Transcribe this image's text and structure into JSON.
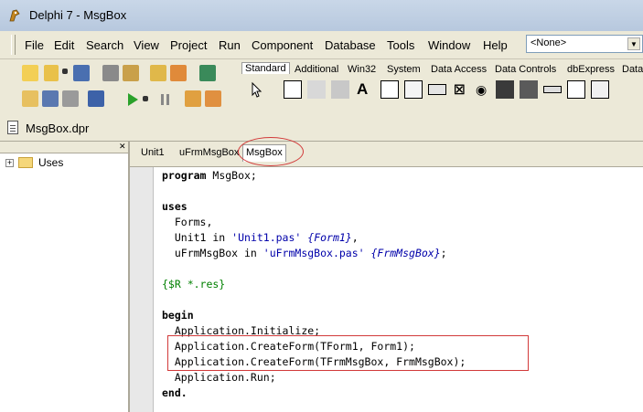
{
  "window": {
    "title": "Delphi 7 - MsgBox"
  },
  "menu": {
    "items": [
      "File",
      "Edit",
      "Search",
      "View",
      "Project",
      "Run",
      "Component",
      "Database",
      "Tools",
      "Window",
      "Help"
    ]
  },
  "combo": {
    "value": "<None>"
  },
  "palette": {
    "tabs": [
      "Standard",
      "Additional",
      "Win32",
      "System",
      "Data Access",
      "Data Controls",
      "dbExpress",
      "Data"
    ],
    "active_tab": "Standard",
    "icons": [
      "pointer-icon",
      "frame-icon",
      "mainmenu-icon",
      "popupmenu-icon",
      "label-icon",
      "edit-icon",
      "memo-icon",
      "button-icon",
      "checkbox-icon",
      "radiobutton-icon",
      "listbox-icon",
      "combobox-icon",
      "scrollbar-icon",
      "groupbox-icon",
      "radiogroup-icon"
    ]
  },
  "module": {
    "title": "MsgBox.dpr"
  },
  "tree": {
    "label": "Uses"
  },
  "editor_tabs": [
    "Unit1",
    "uFrmMsgBox",
    "MsgBox"
  ],
  "code": {
    "l1_kw": "program",
    "l1_rest": " MsgBox;",
    "l3_kw": "uses",
    "l4": "  Forms,",
    "l5_a": "  Unit1 in ",
    "l5_str": "'Unit1.pas'",
    "l5_cmt": " {Form1}",
    "l5_end": ",",
    "l6_a": "  uFrmMsgBox in ",
    "l6_str": "'uFrmMsgBox.pas'",
    "l6_cmt": " {FrmMsgBox}",
    "l6_end": ";",
    "l8_dir": "{$R *.res}",
    "l10_kw": "begin",
    "l11": "  Application.Initialize;",
    "l12": "  Application.CreateForm(TForm1, Form1);",
    "l13": "  Application.CreateForm(TFrmMsgBox, FrmMsgBox);",
    "l14": "  Application.Run;",
    "l15_kw": "end."
  }
}
